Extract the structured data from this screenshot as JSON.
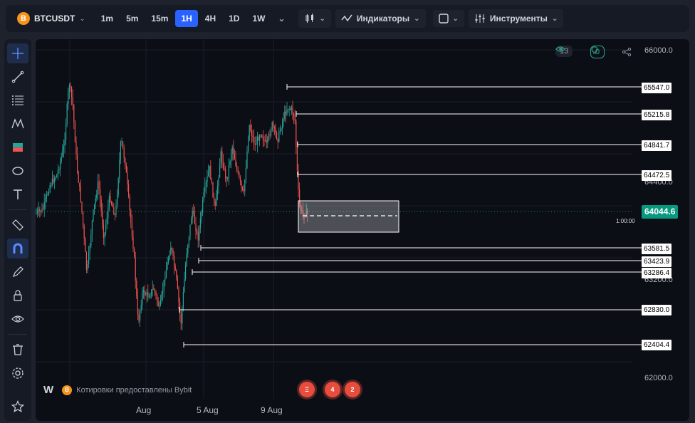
{
  "toolbar": {
    "symbol": "BTCUSDT",
    "symbol_icon": "B",
    "timeframes": [
      "1m",
      "5m",
      "15m",
      "1H",
      "4H",
      "1D",
      "1W"
    ],
    "active_timeframe": "1H",
    "indicators_label": "Индикаторы",
    "instruments_label": "Инструменты"
  },
  "chart": {
    "price_ticks": [
      "66000.0",
      "64400.0",
      "63200.0",
      "62000.0"
    ],
    "levels": [
      "65547.0",
      "65215.8",
      "64841.7",
      "64472.5",
      "63581.5",
      "63423.9",
      "63286.4",
      "62830.0",
      "62404.4"
    ],
    "current_price": "64044.6",
    "countdown": "1:00:00",
    "dates": [
      "Aug",
      "5 Aug",
      "9 Aug"
    ],
    "views_count": "13",
    "ideas_count": "0",
    "attribution": "Котировки предоставлены Bybit",
    "tv_logo": "W",
    "bybit_icon": "B",
    "events": [
      "Ξ",
      "4",
      "2"
    ],
    "colors": {
      "up": "#26a69a",
      "down": "#ef5350",
      "current": "#089981"
    }
  }
}
